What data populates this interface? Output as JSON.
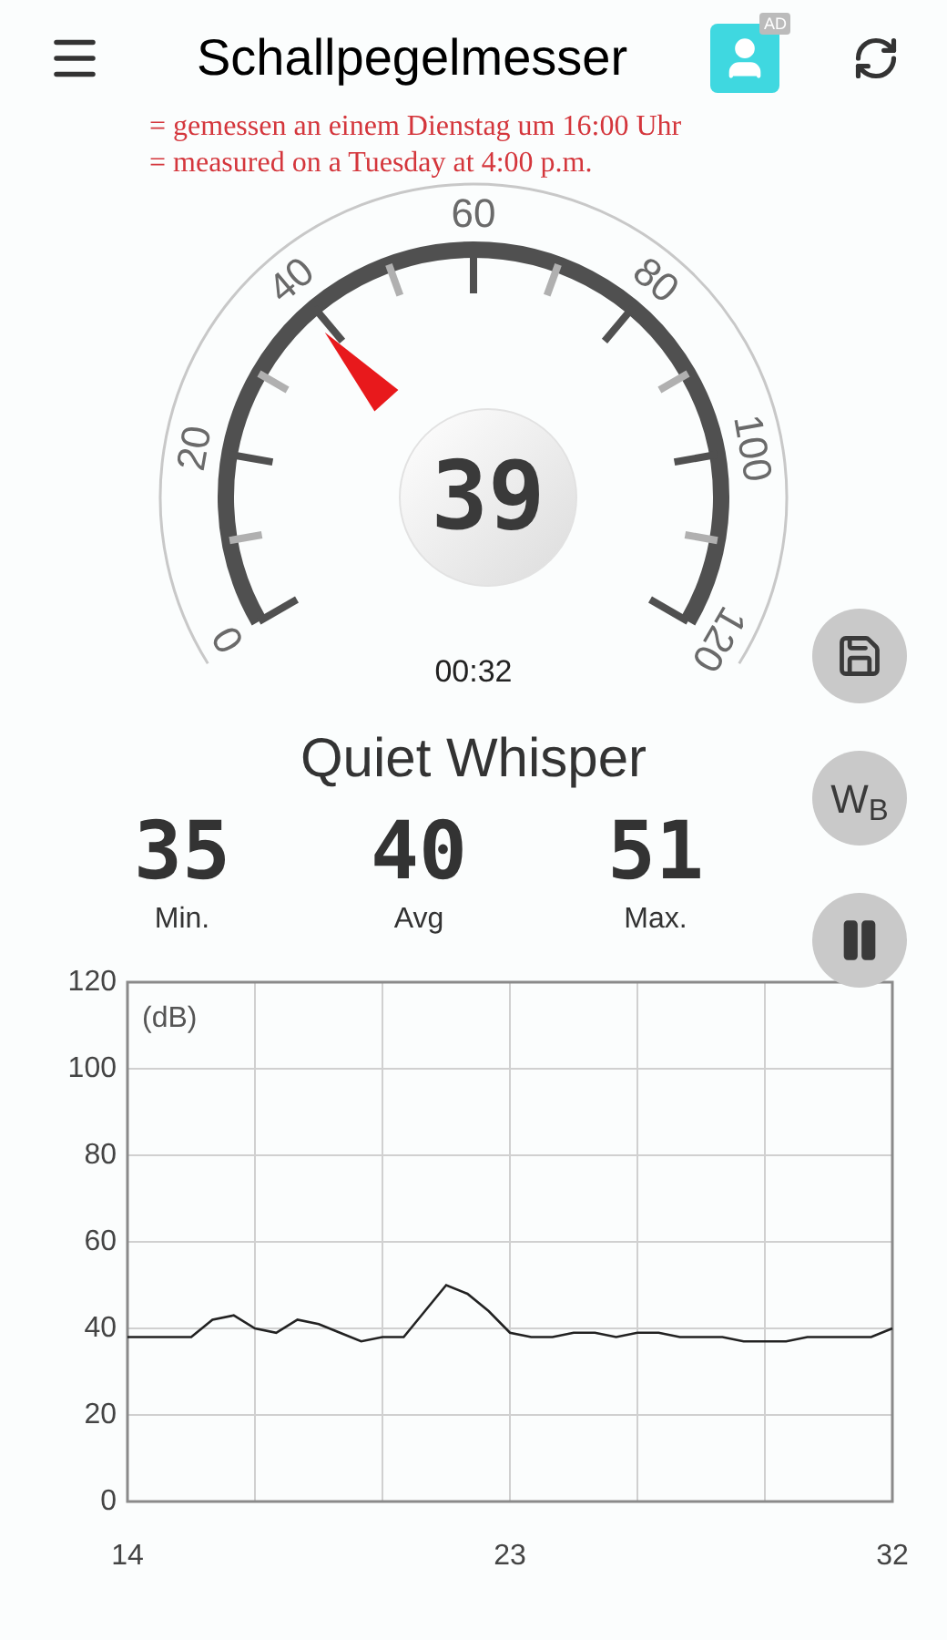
{
  "header": {
    "title": "Schallpegelmesser",
    "ad_badge": "AD"
  },
  "annotation": [
    "= gemessen an einem Dienstag um 16:00 Uhr",
    "= measured on a Tuesday at 4:00 p.m."
  ],
  "gauge": {
    "ticks": [
      "0",
      "20",
      "40",
      "60",
      "80",
      "100",
      "120"
    ],
    "reading": "39",
    "timer": "00:32"
  },
  "classification": "Quiet Whisper",
  "stats": [
    {
      "value": "35",
      "label": "Min."
    },
    {
      "value": "40",
      "label": "Avg"
    },
    {
      "value": "51",
      "label": "Max."
    }
  ],
  "side_buttons": [
    {
      "kind": "save"
    },
    {
      "kind": "text",
      "label": "W$_{B}$"
    },
    {
      "kind": "pause"
    }
  ],
  "chart": {
    "chart_data": {
      "type": "line",
      "grid": true,
      "ylabel": "(dB)",
      "ylim": [
        0,
        120
      ],
      "xlim": [
        14,
        32
      ],
      "yticks": [
        0,
        20,
        40,
        60,
        80,
        100,
        120
      ],
      "xticks": [
        14,
        23,
        32
      ],
      "x": [
        14,
        14.5,
        15,
        15.5,
        16,
        16.5,
        17,
        17.5,
        18,
        18.5,
        19,
        19.5,
        20,
        20.5,
        21,
        21.5,
        22,
        22.5,
        23,
        23.5,
        24,
        24.5,
        25,
        25.5,
        26,
        26.5,
        27,
        27.5,
        28,
        28.5,
        29,
        29.5,
        30,
        30.5,
        31,
        31.5,
        32
      ],
      "series": [
        {
          "color": "#222222",
          "values": [
            38,
            38,
            38,
            38,
            42,
            43,
            40,
            39,
            42,
            41,
            39,
            37,
            38,
            38,
            44,
            50,
            48,
            44,
            39,
            38,
            38,
            39,
            39,
            38,
            39,
            39,
            38,
            38,
            38,
            37,
            37,
            37,
            38,
            38,
            38,
            38,
            40
          ]
        }
      ]
    }
  }
}
